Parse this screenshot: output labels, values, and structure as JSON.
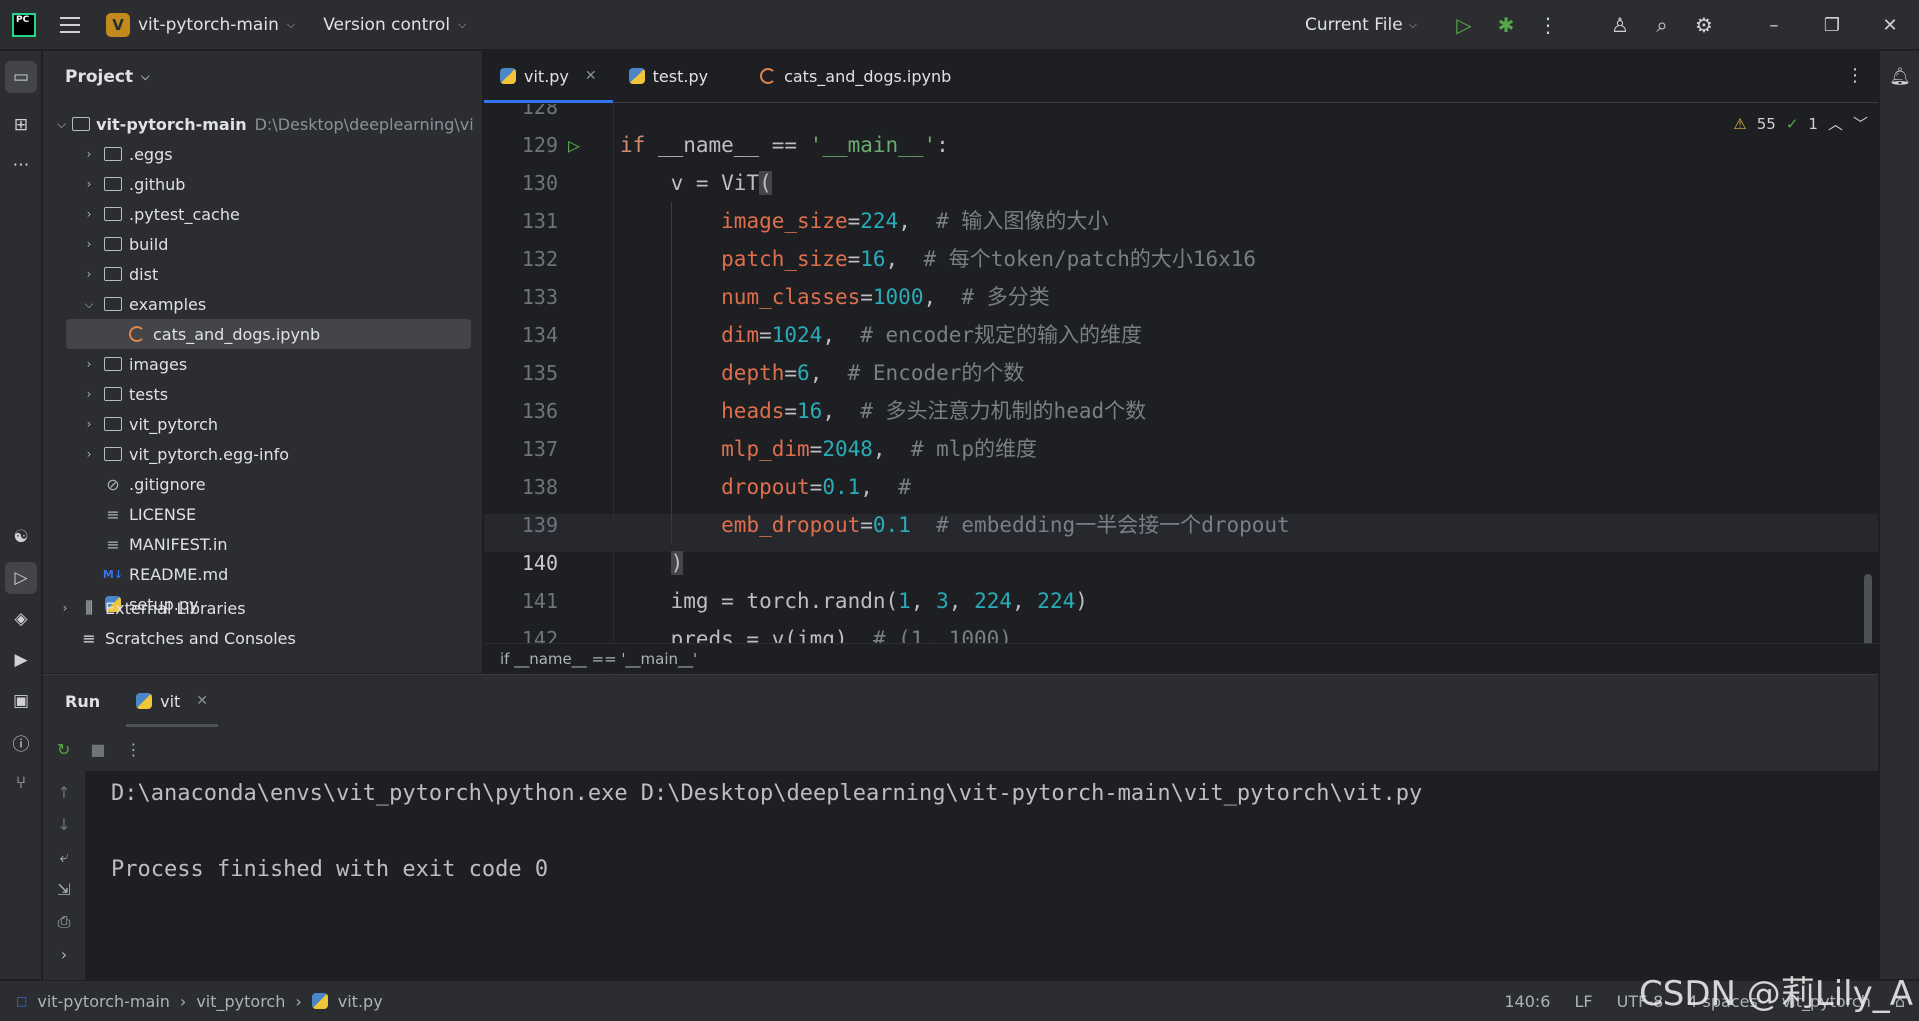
{
  "titlebar": {
    "logo": "PC",
    "project_badge": "V",
    "project": "vit-pytorch-main",
    "vcs": "Version control",
    "run_config": "Current File"
  },
  "project_panel": {
    "title": "Project",
    "root": {
      "name": "vit-pytorch-main",
      "path": "D:\\Desktop\\deeplearning\\vi"
    },
    "items": [
      {
        "label": ".eggs",
        "type": "folder",
        "indent": 1,
        "expandable": true
      },
      {
        "label": ".github",
        "type": "folder",
        "indent": 1,
        "expandable": true
      },
      {
        "label": ".pytest_cache",
        "type": "folder",
        "indent": 1,
        "expandable": true
      },
      {
        "label": "build",
        "type": "folder",
        "indent": 1,
        "expandable": true
      },
      {
        "label": "dist",
        "type": "folder",
        "indent": 1,
        "expandable": true
      },
      {
        "label": "examples",
        "type": "folder",
        "indent": 1,
        "expanded": true
      },
      {
        "label": "cats_and_dogs.ipynb",
        "type": "notebook",
        "indent": 2,
        "selected": true
      },
      {
        "label": "images",
        "type": "folder",
        "indent": 1,
        "expandable": true
      },
      {
        "label": "tests",
        "type": "folder",
        "indent": 1,
        "expandable": true
      },
      {
        "label": "vit_pytorch",
        "type": "package",
        "indent": 1,
        "expandable": true
      },
      {
        "label": "vit_pytorch.egg-info",
        "type": "folder",
        "indent": 1,
        "expandable": true
      },
      {
        "label": ".gitignore",
        "type": "ignore",
        "indent": 1
      },
      {
        "label": "LICENSE",
        "type": "text",
        "indent": 1
      },
      {
        "label": "MANIFEST.in",
        "type": "text",
        "indent": 1
      },
      {
        "label": "README.md",
        "type": "md",
        "indent": 1
      },
      {
        "label": "setup.py",
        "type": "python",
        "indent": 1
      }
    ],
    "external": "External Libraries",
    "scratches": "Scratches and Consoles"
  },
  "tabs": [
    {
      "label": "vit.py",
      "active": true
    },
    {
      "label": "test.py"
    },
    {
      "label": "cats_and_dogs.ipynb"
    }
  ],
  "inspections": {
    "warnings": "55",
    "ok": "1"
  },
  "code": {
    "partial_top": "128",
    "partial_bottom": "142",
    "current_line": "140"
  },
  "editor_breadcrumb": "if __name__ == '__main__'",
  "run": {
    "title": "Run",
    "tab": "vit",
    "cmd": "D:\\anaconda\\envs\\vit_pytorch\\python.exe D:\\Desktop\\deeplearning\\vit-pytorch-main\\vit_pytorch\\vit.py",
    "exit": "Process finished with exit code 0"
  },
  "status": {
    "crumbs": [
      "vit-pytorch-main",
      "vit_pytorch",
      "vit.py"
    ],
    "pos": "140:6",
    "sep": "LF",
    "enc": "UTF-8",
    "indent": "4 spaces",
    "interp": "vit_pytorch"
  },
  "watermark": "CSDN @莉Lily_A"
}
